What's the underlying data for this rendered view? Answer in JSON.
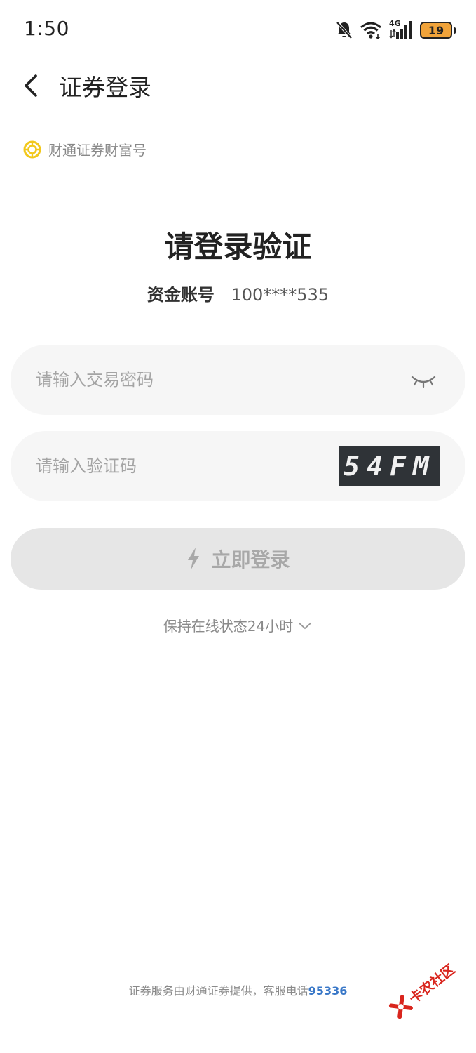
{
  "status_bar": {
    "time": "1:50",
    "network": "4G",
    "battery": "19",
    "battery_level_percent": 19,
    "icons": [
      "bell-off-icon",
      "wifi-icon",
      "signal-4g-icon",
      "battery-icon"
    ]
  },
  "nav": {
    "title": "证券登录",
    "back_icon": "chevron-left-icon"
  },
  "brand": {
    "label": "财通证券财富号",
    "accent": "#f2c81b"
  },
  "login": {
    "headline": "请登录验证",
    "account_label": "资金账号",
    "account_value": "100****535",
    "password_placeholder": "请输入交易密码",
    "captcha_placeholder": "请输入验证码",
    "captcha_text": "54FM",
    "submit_label": "立即登录",
    "keep_online_label": "保持在线状态24小时"
  },
  "footer": {
    "text": "证券服务由财通证券提供，客服电话",
    "phone": "95336"
  },
  "watermark": {
    "text": "卡农社区"
  },
  "colors": {
    "background": "#ffffff",
    "input_bg": "#f6f6f6",
    "button_disabled_bg": "#e6e6e6",
    "link": "#3a78c8",
    "battery": "#f0a33a",
    "watermark": "#d9251d"
  }
}
